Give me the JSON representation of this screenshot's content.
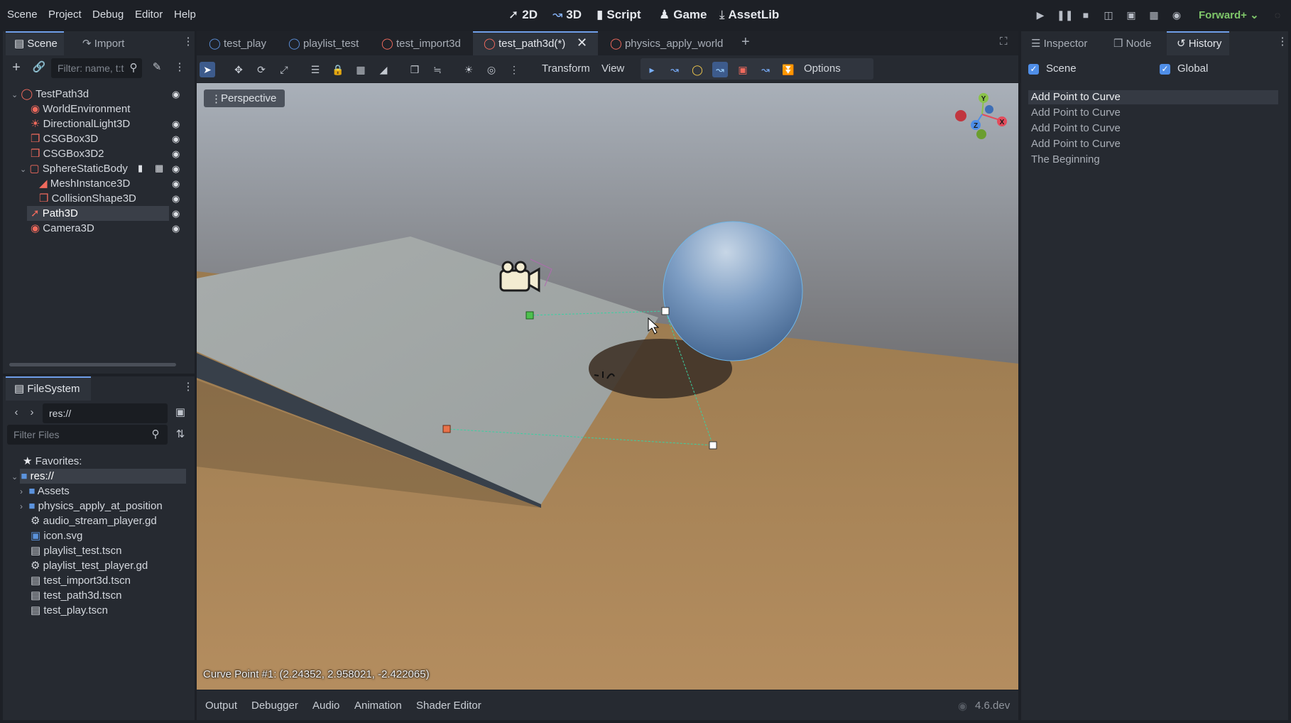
{
  "menus": [
    "Scene",
    "Project",
    "Debug",
    "Editor",
    "Help"
  ],
  "modes": [
    {
      "label": "2D",
      "icon": "2d-icon"
    },
    {
      "label": "3D",
      "icon": "3d-icon"
    },
    {
      "label": "Script",
      "icon": "script-icon"
    },
    {
      "label": "Game",
      "icon": "game-icon"
    },
    {
      "label": "AssetLib",
      "icon": "assetlib-icon"
    }
  ],
  "renderer": "Forward+",
  "left_dock": {
    "tabs": [
      "Scene",
      "Import"
    ],
    "filter_placeholder": "Filter: name, t:t",
    "tree": [
      {
        "label": "TestPath3d",
        "icon": "node3d-icon",
        "color": "#f06a5d"
      },
      {
        "label": "WorldEnvironment",
        "icon": "world-environment-icon",
        "color": "#f06a5d"
      },
      {
        "label": "DirectionalLight3D",
        "icon": "light-icon",
        "color": "#f06a5d"
      },
      {
        "label": "CSGBox3D",
        "icon": "csgbox-icon",
        "color": "#f06a5d"
      },
      {
        "label": "CSGBox3D2",
        "icon": "csgbox-icon",
        "color": "#f06a5d"
      },
      {
        "label": "SphereStaticBody",
        "icon": "static-body-icon",
        "color": "#f06a5d"
      },
      {
        "label": "MeshInstance3D",
        "icon": "mesh-instance-icon",
        "color": "#f06a5d"
      },
      {
        "label": "CollisionShape3D",
        "icon": "collision-shape-icon",
        "color": "#f06a5d"
      },
      {
        "label": "Path3D",
        "icon": "path3d-icon",
        "color": "#f06a5d"
      },
      {
        "label": "Camera3D",
        "icon": "camera-icon",
        "color": "#f06a5d"
      }
    ]
  },
  "filesystem": {
    "tab": "FileSystem",
    "path": "res://",
    "filter_placeholder": "Filter Files",
    "items": [
      {
        "label": "Favorites:",
        "icon": "star-icon"
      },
      {
        "label": "res://",
        "icon": "folder-icon"
      },
      {
        "label": "Assets",
        "icon": "folder-icon"
      },
      {
        "label": "physics_apply_at_position",
        "icon": "folder-icon"
      },
      {
        "label": "audio_stream_player.gd",
        "icon": "gear-icon"
      },
      {
        "label": "icon.svg",
        "icon": "image-icon"
      },
      {
        "label": "playlist_test.tscn",
        "icon": "scene-icon"
      },
      {
        "label": "playlist_test_player.gd",
        "icon": "gear-icon"
      },
      {
        "label": "test_import3d.tscn",
        "icon": "scene-icon"
      },
      {
        "label": "test_path3d.tscn",
        "icon": "scene-icon"
      },
      {
        "label": "test_play.tscn",
        "icon": "scene-icon"
      }
    ]
  },
  "scene_tabs": [
    "test_play",
    "playlist_test",
    "test_import3d",
    "test_path3d(*)",
    "physics_apply_world"
  ],
  "viewport_toolbar": {
    "transform": "Transform",
    "view": "View",
    "options": "Options"
  },
  "viewport": {
    "perspective": "Perspective",
    "status": "Curve Point #1: (2.24352, 2.958021, -2.422065)",
    "gizmo_axes": [
      "Y",
      "X",
      "Z"
    ]
  },
  "bottom_tabs": [
    "Output",
    "Debugger",
    "Audio",
    "Animation",
    "Shader Editor"
  ],
  "version": "4.6.dev",
  "right_dock": {
    "tabs": [
      "Inspector",
      "Node",
      "History"
    ],
    "scene_label": "Scene",
    "global_label": "Global",
    "history": [
      "Add Point to Curve",
      "Add Point to Curve",
      "Add Point to Curve",
      "Add Point to Curve",
      "The Beginning"
    ]
  }
}
